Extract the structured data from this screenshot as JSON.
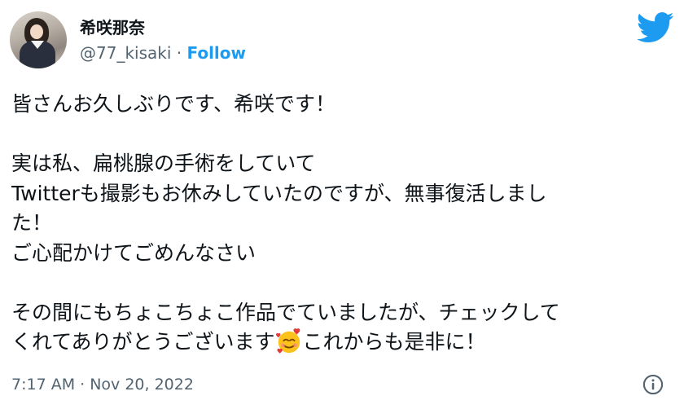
{
  "author": {
    "display_name": "希咲那奈",
    "handle": "@77_kisaki",
    "separator": " · ",
    "follow_label": "Follow"
  },
  "tweet": {
    "line_1": "皆さんお久しぶりです、希咲です！",
    "line_2": "実は私、扁桃腺の手術をしていて",
    "line_3": "Twitterも撮影もお休みしていたのですが、無事復活しまし",
    "line_4": "た！",
    "line_5": "ご心配かけてごめんなさい",
    "line_6": "その間にもちょこちょこ作品でていましたが、チェックして",
    "line_7a": "くれてありがとうございます",
    "emoji": "smiling-face-with-hearts",
    "line_7b": "これからも是非に！"
  },
  "footer": {
    "timestamp": "7:17 AM · Nov 20, 2022"
  },
  "icons": {
    "brand": "twitter-bird-icon",
    "info": "info-icon"
  },
  "colors": {
    "twitter_blue": "#1d9bf0",
    "text_primary": "#0f1419",
    "text_secondary": "#536471"
  }
}
